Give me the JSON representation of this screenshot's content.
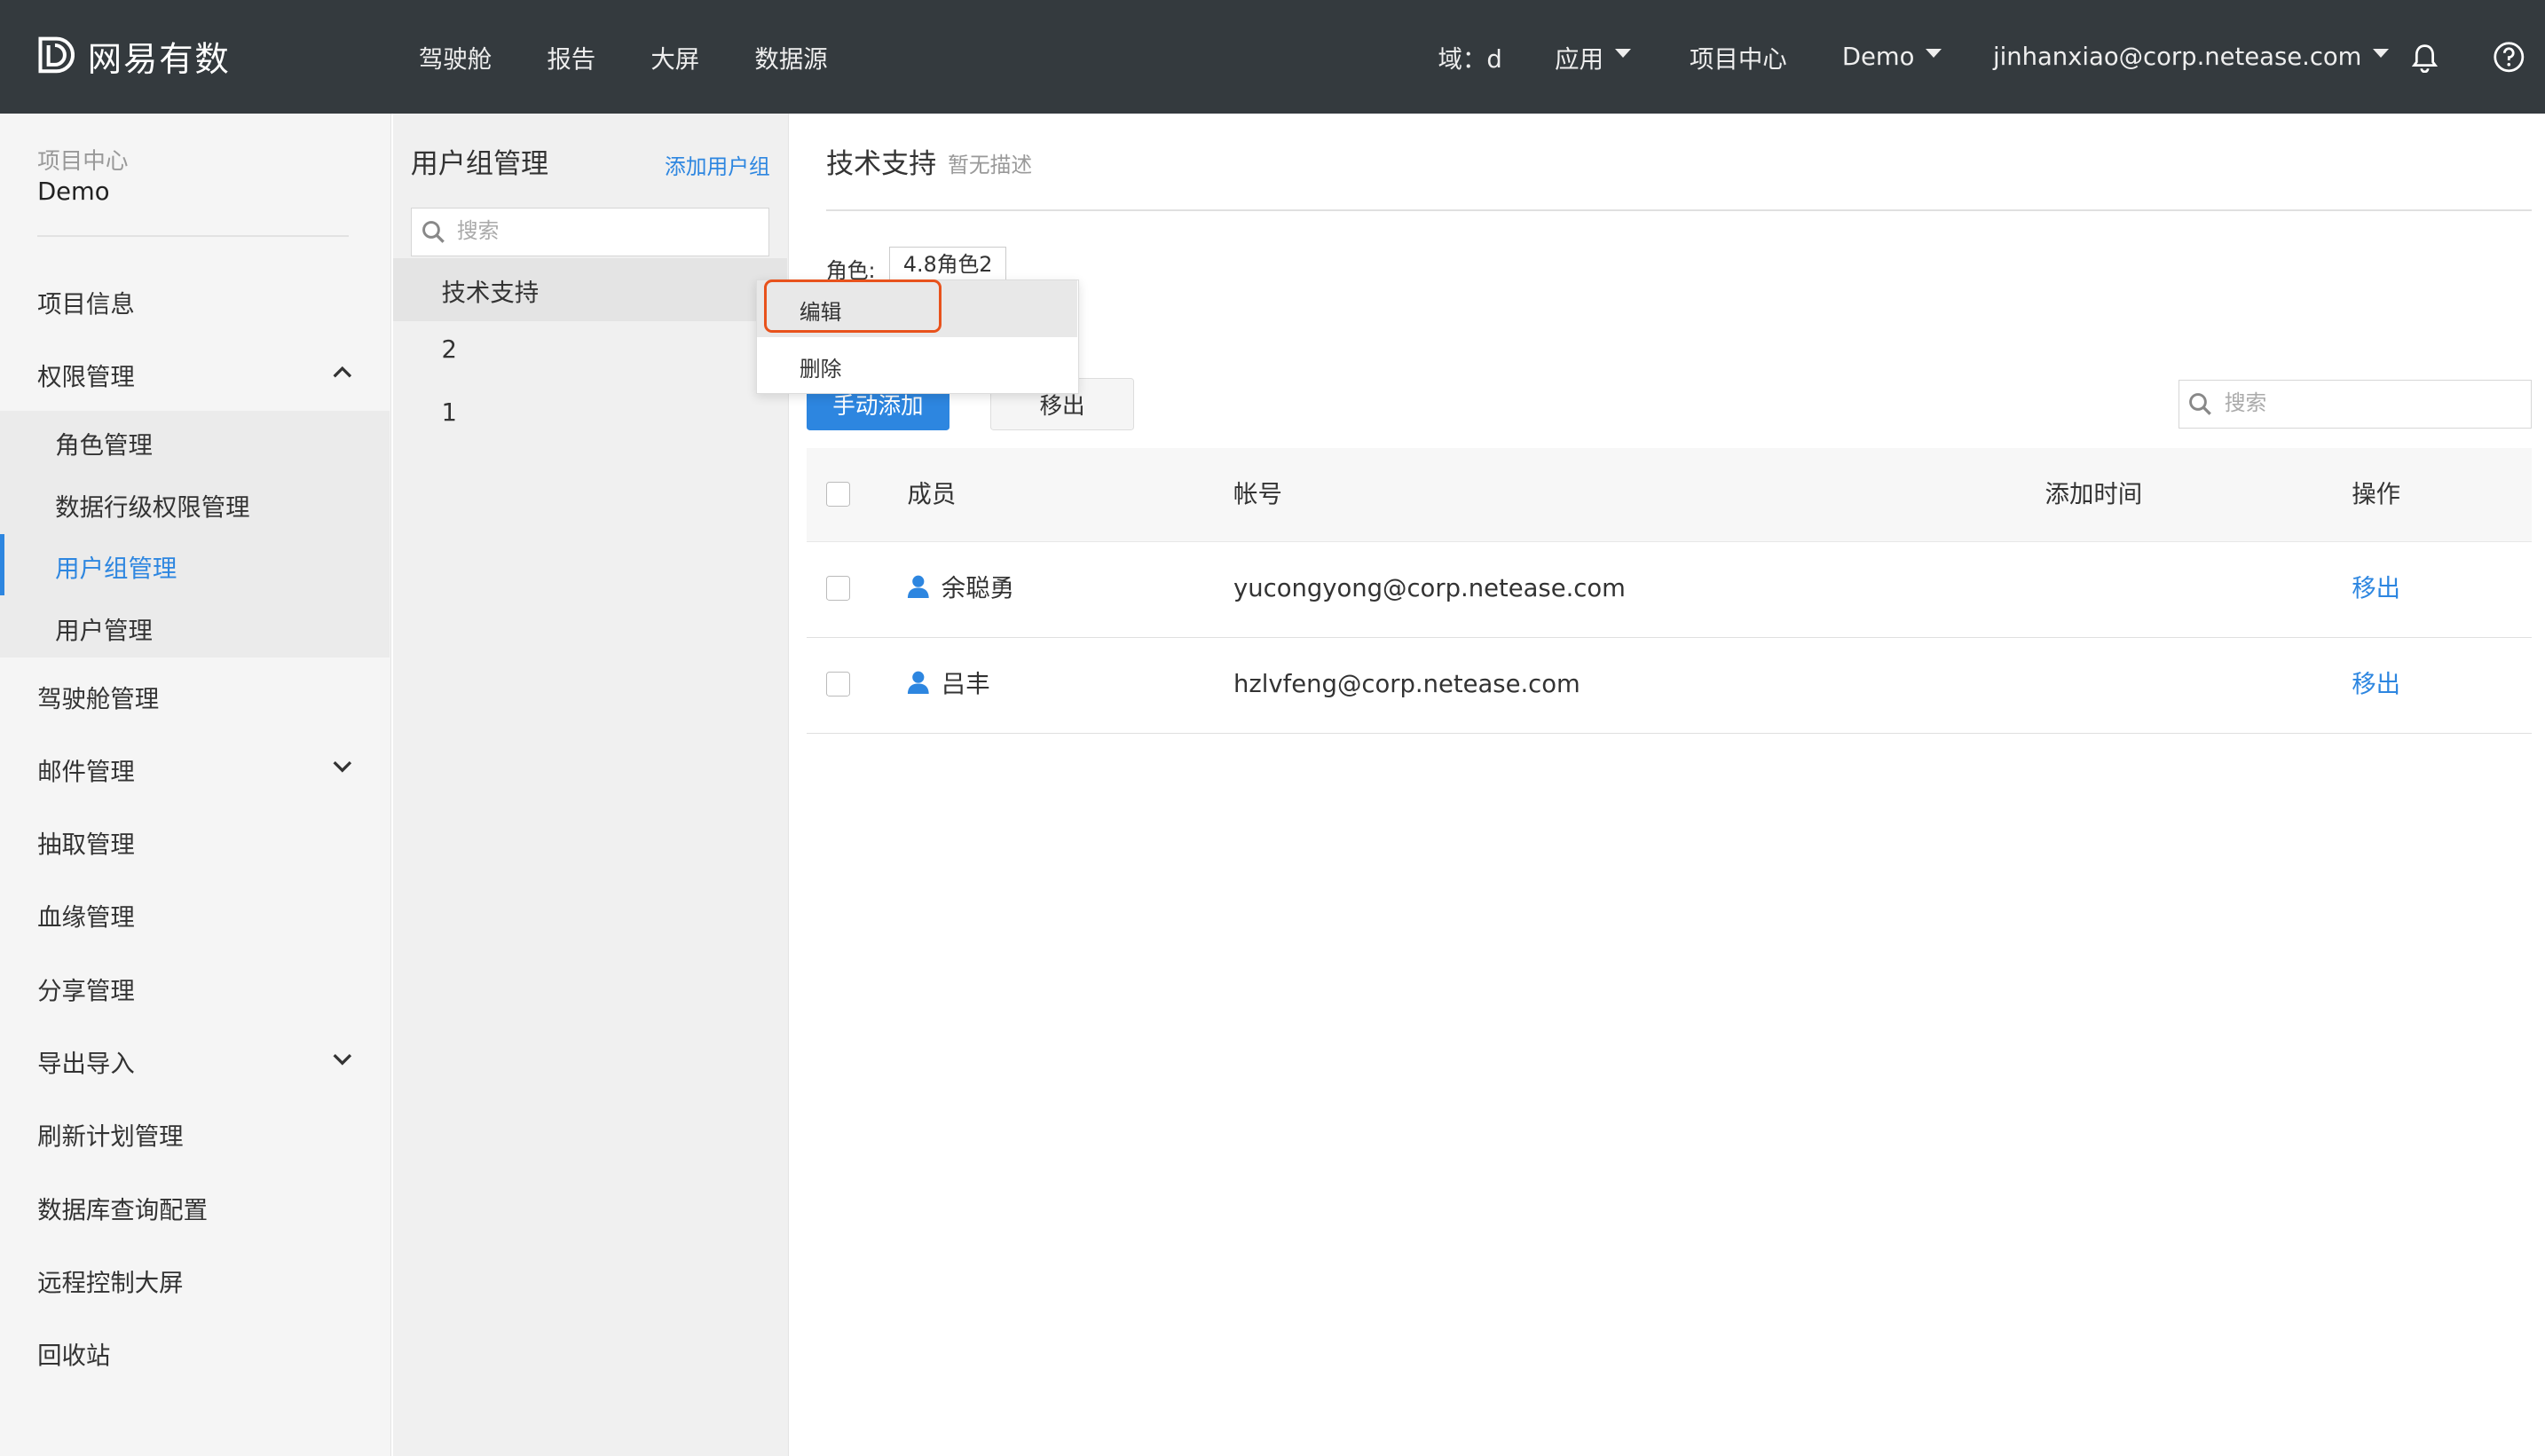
{
  "topbar": {
    "logo_text": "网易有数",
    "nav": [
      "驾驶舱",
      "报告",
      "大屏",
      "数据源"
    ],
    "domain_label": "域：d",
    "app_menu": "应用",
    "project_center": "项目中心",
    "project_menu": "Demo",
    "user_email": "jinhanxiao@corp.netease.com"
  },
  "sidebar": {
    "project_label": "项目中心",
    "project_name": "Demo",
    "items": [
      "项目信息",
      "权限管理",
      "驾驶舱管理",
      "邮件管理",
      "抽取管理",
      "血缘管理",
      "分享管理",
      "导出导入",
      "刷新计划管理",
      "数据库查询配置",
      "远程控制大屏",
      "回收站"
    ],
    "sub_items": [
      "角色管理",
      "数据行级权限管理",
      "用户组管理",
      "用户管理"
    ]
  },
  "groups": {
    "title": "用户组管理",
    "add_link": "添加用户组",
    "search_placeholder": "搜索",
    "list": [
      "技术支持",
      "2",
      "1"
    ]
  },
  "dropdown": {
    "items": [
      "编辑",
      "删除"
    ]
  },
  "main": {
    "title": "技术支持",
    "desc": "暂无描述",
    "role_label": "角色:",
    "role_tag": "4.8角色2",
    "add_button": "手动添加",
    "remove_button": "移出",
    "search_placeholder": "搜索",
    "columns": [
      "成员",
      "帐号",
      "添加时间",
      "操作"
    ],
    "rows": [
      {
        "name": "余聪勇",
        "account": "yucongyong@corp.netease.com",
        "time": "",
        "action": "移出"
      },
      {
        "name": "吕丰",
        "account": "hzlvfeng@corp.netease.com",
        "time": "",
        "action": "移出"
      }
    ]
  },
  "colors": {
    "topbar": "#343a3e",
    "accent": "#2d86e0",
    "highlight_border": "#e8521c"
  }
}
